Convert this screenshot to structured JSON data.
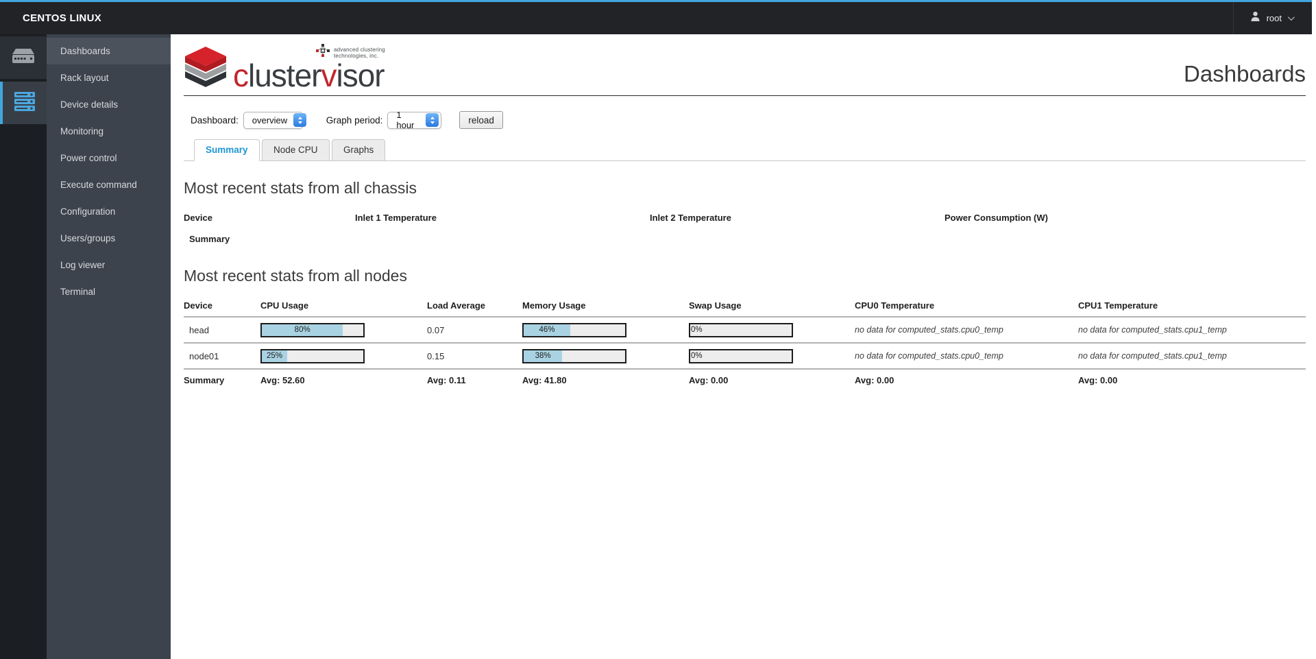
{
  "colors": {
    "accent_blue": "#41a7dd",
    "link_blue": "#1f95d4",
    "bar_fill": "#a9d3e2",
    "logo_red": "#c1272d",
    "sidebar_bg": "#3c434c",
    "topbar_bg": "#212327"
  },
  "topbar": {
    "brand": "CENTOS LINUX",
    "user": "root"
  },
  "sidebar": {
    "items": [
      {
        "label": "Dashboards",
        "active": true
      },
      {
        "label": "Rack layout",
        "active": false
      },
      {
        "label": "Device details",
        "active": false
      },
      {
        "label": "Monitoring",
        "active": false
      },
      {
        "label": "Power control",
        "active": false
      },
      {
        "label": "Execute command",
        "active": false
      },
      {
        "label": "Configuration",
        "active": false
      },
      {
        "label": "Users/groups",
        "active": false
      },
      {
        "label": "Log viewer",
        "active": false
      },
      {
        "label": "Terminal",
        "active": false
      }
    ]
  },
  "header": {
    "title": "Dashboards",
    "logo": {
      "word_parts": {
        "p1": "c",
        "p2": "luster",
        "p3": "v",
        "p4": "isor"
      },
      "tagline_line1": "advanced clustering",
      "tagline_line2": "technologies, inc."
    }
  },
  "controls": {
    "dashboard_label": "Dashboard:",
    "dashboard_value": "overview",
    "graph_period_label": "Graph period:",
    "graph_period_value": "1 hour",
    "reload_label": "reload"
  },
  "tabs": {
    "summary": "Summary",
    "node_cpu": "Node CPU",
    "graphs": "Graphs"
  },
  "chassis_section": {
    "heading": "Most recent stats from all chassis",
    "columns": [
      "Device",
      "Inlet 1 Temperature",
      "Inlet 2 Temperature",
      "Power Consumption (W)"
    ],
    "rows": [
      {
        "device": "Summary",
        "inlet1": "",
        "inlet2": "",
        "power": ""
      }
    ]
  },
  "nodes_section": {
    "heading": "Most recent stats from all nodes",
    "columns": [
      "Device",
      "CPU Usage",
      "Load Average",
      "Memory Usage",
      "Swap Usage",
      "CPU0 Temperature",
      "CPU1 Temperature"
    ],
    "rows": [
      {
        "device": "head",
        "cpu_pct": 80,
        "cpu_label": "80%",
        "load": "0.07",
        "mem_pct": 46,
        "mem_label": "46%",
        "swap_pct": 0,
        "swap_label": "0%",
        "cpu0": "no data for computed_stats.cpu0_temp",
        "cpu1": "no data for computed_stats.cpu1_temp"
      },
      {
        "device": "node01",
        "cpu_pct": 25,
        "cpu_label": "25%",
        "load": "0.15",
        "mem_pct": 38,
        "mem_label": "38%",
        "swap_pct": 0,
        "swap_label": "0%",
        "cpu0": "no data for computed_stats.cpu0_temp",
        "cpu1": "no data for computed_stats.cpu1_temp"
      }
    ],
    "summary_row": {
      "device": "Summary",
      "cpu": "Avg: 52.60",
      "load": "Avg: 0.11",
      "mem": "Avg: 41.80",
      "swap": "Avg: 0.00",
      "cpu0": "Avg: 0.00",
      "cpu1": "Avg: 0.00"
    }
  }
}
